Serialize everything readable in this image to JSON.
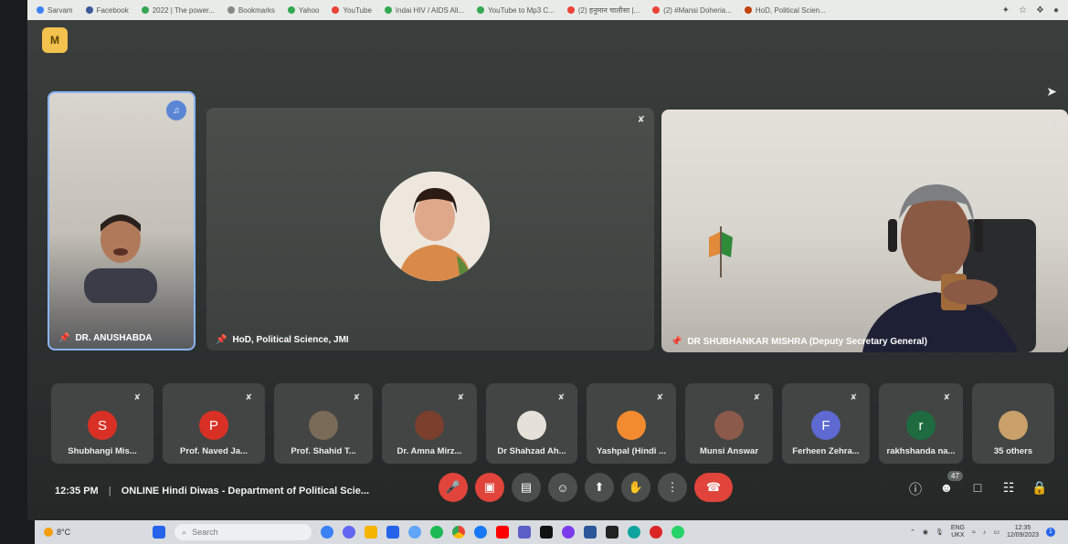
{
  "bookmarks": {
    "items": [
      {
        "label": "Sarvam",
        "color": "#3b82f6"
      },
      {
        "label": "Facebook",
        "color": "#3b5998"
      },
      {
        "label": "2022 | The power...",
        "color": "#34a853"
      },
      {
        "label": "Bookmarks",
        "color": "#888888"
      },
      {
        "label": "Yahoo",
        "color": "#34a853"
      },
      {
        "label": "YouTube",
        "color": "#ea4335"
      },
      {
        "label": "Indai HIV / AIDS All...",
        "color": "#34a853"
      },
      {
        "label": "YouTube to Mp3 C...",
        "color": "#34a853"
      },
      {
        "label": "(2) हनुमान चालीसा |...",
        "color": "#ea4335"
      },
      {
        "label": "(2) #Mansi Doheria...",
        "color": "#ea4335"
      },
      {
        "label": "HoD, Political Scien...",
        "color": "#c2410c"
      }
    ]
  },
  "meet": {
    "logo": "M",
    "tiles": {
      "tile1_name": "DR. ANUSHABDA",
      "tile2_name": "HoD, Political Science, JMI",
      "tile3_name": "DR SHUBHANKAR MISHRA (Deputy Secretary General)"
    },
    "participants": [
      {
        "name": "Shubhangi Mis...",
        "initial": "S",
        "color": "#d93025"
      },
      {
        "name": "Prof. Naved Ja...",
        "initial": "P",
        "color": "#d93025"
      },
      {
        "name": "Prof. Shahid T...",
        "initial": "",
        "color": "#7a6a58"
      },
      {
        "name": "Dr. Amna Mirz...",
        "initial": "",
        "color": "#7b3f2e"
      },
      {
        "name": "Dr Shahzad Ah...",
        "initial": "",
        "color": "#e6e1d8"
      },
      {
        "name": "Yashpal (Hindi ...",
        "initial": "",
        "color": "#f28b30"
      },
      {
        "name": "Munsi Answar",
        "initial": "",
        "color": "#8b5a4a"
      },
      {
        "name": "Ferheen Zehra...",
        "initial": "F",
        "color": "#5e6ad2"
      },
      {
        "name": "rakhshanda na...",
        "initial": "r",
        "color": "#1e6b40"
      },
      {
        "name": "35 others",
        "initial": "",
        "color": "#c9a06a"
      }
    ],
    "time": "12:35 PM",
    "separator": "|",
    "meeting_title": "ONLINE Hindi Diwas - Department of Political Scie...",
    "participant_count": "47"
  },
  "taskbar": {
    "weather_temp": "8°C",
    "search_placeholder": "Search",
    "lang_top": "ENG",
    "lang_bottom": "UKX",
    "clock_time": "12:35",
    "clock_date": "12/09/2023"
  }
}
